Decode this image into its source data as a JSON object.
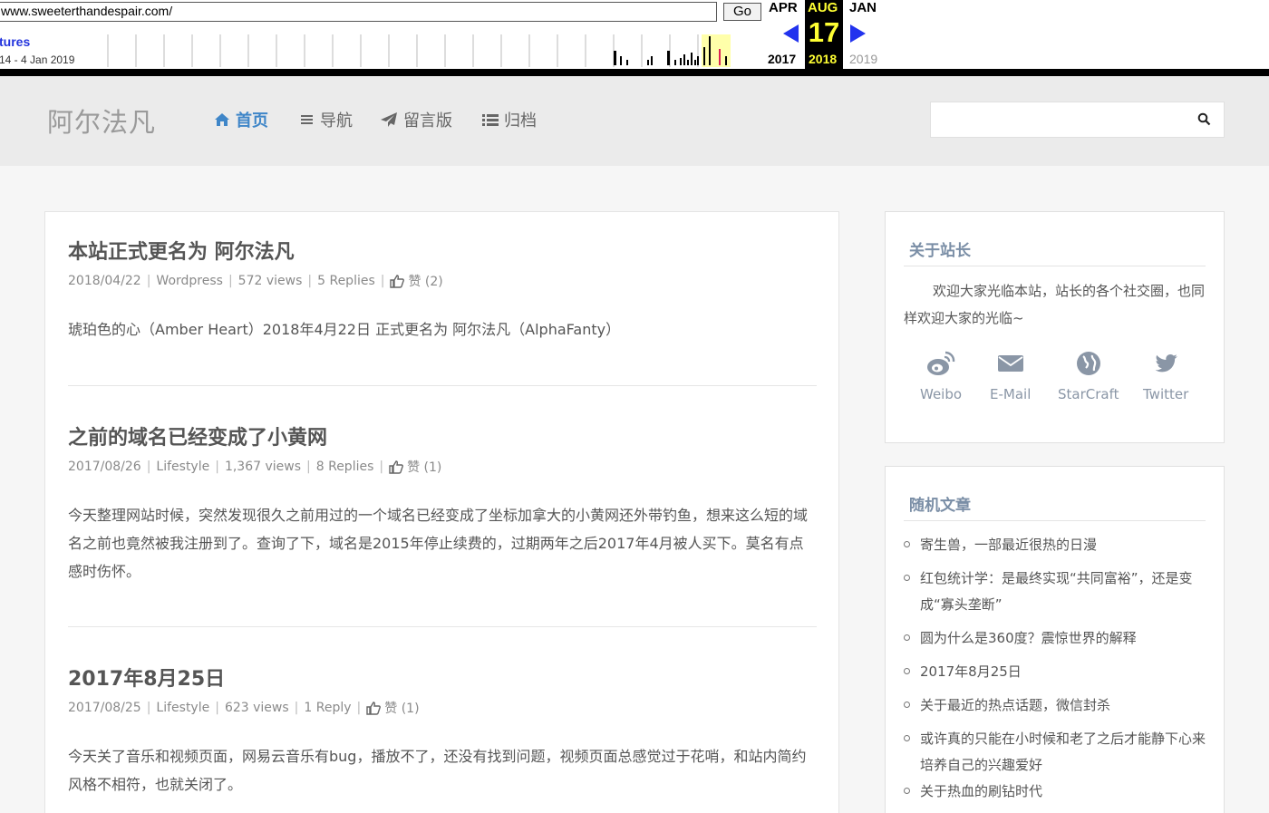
{
  "wayback": {
    "url": "www.sweeterthandespair.com/",
    "go_label": "Go",
    "captures_label": "tures",
    "date_range": "14 - 4 Jan 2019",
    "prev_month": "APR",
    "cur_month": "AUG",
    "next_month": "JAN",
    "cur_day": "17",
    "prev_year": "2017",
    "cur_year": "2018",
    "next_year": "2019"
  },
  "site": {
    "logo": "阿尔法凡",
    "nav": [
      {
        "label": "首页",
        "icon": "home-icon"
      },
      {
        "label": "导航",
        "icon": "menu-icon"
      },
      {
        "label": "留言版",
        "icon": "paper-plane-icon"
      },
      {
        "label": "归档",
        "icon": "list-icon"
      }
    ],
    "search_placeholder": ""
  },
  "posts": [
    {
      "title": "本站正式更名为 阿尔法凡",
      "date": "2018/04/22",
      "category": "Wordpress",
      "views": "572 views",
      "replies": "5 Replies",
      "likes": "赞 (2)",
      "excerpt": "琥珀色的心（Amber Heart）2018年4月22日 正式更名为 阿尔法凡（AlphaFanty）"
    },
    {
      "title": "之前的域名已经变成了小黄网",
      "date": "2017/08/26",
      "category": "Lifestyle",
      "views": "1,367 views",
      "replies": "8 Replies",
      "likes": "赞 (1)",
      "excerpt": "今天整理网站时候，突然发现很久之前用过的一个域名已经变成了坐标加拿大的小黄网还外带钓鱼，想来这么短的域名之前也竟然被我注册到了。查询了下，域名是2015年停止续费的，过期两年之后2017年4月被人买下。莫名有点感时伤怀。"
    },
    {
      "title": "2017年8月25日",
      "date": "2017/08/25",
      "category": "Lifestyle",
      "views": "623 views",
      "replies": "1 Reply",
      "likes": "赞 (1)",
      "excerpt": "今天关了音乐和视频页面，网易云音乐有bug，播放不了，还没有找到问题，视频页面总感觉过于花哨，和站内简约风格不相符，也就关闭了。"
    }
  ],
  "sidebar": {
    "about_title": "关于站长",
    "about_text": "欢迎大家光临本站，站长的各个社交圈，也同样欢迎大家的光临~",
    "social": [
      {
        "label": "Weibo",
        "icon": "weibo-icon"
      },
      {
        "label": "E-Mail",
        "icon": "email-icon"
      },
      {
        "label": "StarCraft",
        "icon": "globe-icon"
      },
      {
        "label": "Twitter",
        "icon": "twitter-icon"
      }
    ],
    "random_title": "随机文章",
    "random_posts": [
      "寄生兽，一部最近很热的日漫",
      "红包统计学：是最终实现“共同富裕”，还是变成“寡头垄断”",
      "圆为什么是360度？震惊世界的解释",
      "2017年8月25日",
      "关于最近的热点话题，微信封杀",
      "或许真的只能在小时候和老了之后才能静下心来培养自己的兴趣爱好",
      "关于热血的刷钻时代"
    ]
  },
  "colors": {
    "accent": "#3f86c8",
    "sidebar_title": "#7a8ea6",
    "wayback_arrow": "#2233ee",
    "wayback_day": "#ffff33"
  }
}
